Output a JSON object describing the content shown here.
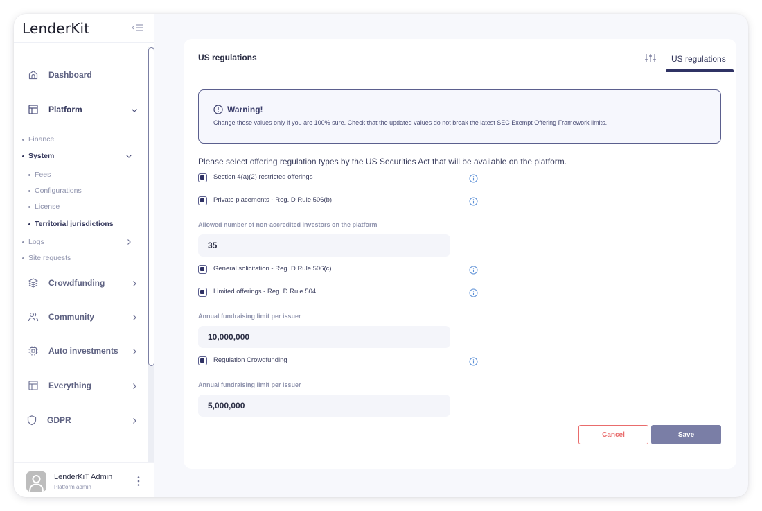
{
  "app": {
    "logo": "LenderKit"
  },
  "sidebar": {
    "collapse_icon": "collapse-menu-icon",
    "items": [
      {
        "label": "Dashboard",
        "icon": "home-icon"
      },
      {
        "label": "Platform",
        "icon": "layout-icon",
        "expanded": true
      },
      {
        "label": "Crowdfunding",
        "icon": "layers-icon"
      },
      {
        "label": "Community",
        "icon": "users-icon"
      },
      {
        "label": "Auto investments",
        "icon": "chip-icon"
      },
      {
        "label": "Everything",
        "icon": "layout-icon"
      },
      {
        "label": "GDPR",
        "icon": "shield-icon"
      }
    ],
    "platform_children": [
      {
        "label": "Finance"
      },
      {
        "label": "System",
        "expanded": true
      },
      {
        "label": "Logs"
      },
      {
        "label": "Site requests"
      }
    ],
    "system_children": [
      {
        "label": "Fees"
      },
      {
        "label": "Configurations"
      },
      {
        "label": "License"
      },
      {
        "label": "Territorial jurisdictions",
        "active": true
      }
    ],
    "user": {
      "name": "LenderKiT Admin",
      "role": "Platform admin"
    }
  },
  "main": {
    "title": "US regulations",
    "tabs": [
      {
        "label": "US regulations",
        "active": true
      }
    ],
    "warning": {
      "title": "Warning!",
      "text": "Change these values only if you are 100% sure. Check that the updated values do not break the latest SEC Exempt Offering Framework limits."
    },
    "intro": "Please select offering regulation types by the US Securities Act that will be available on the platform.",
    "options": [
      {
        "label": "Section 4(a)(2) restricted offerings",
        "checked": true
      },
      {
        "label": "Private placements - Reg. D Rule 506(b)",
        "checked": true
      },
      {
        "label": "General solicitation - Reg. D Rule 506(c)",
        "checked": true
      },
      {
        "label": "Limited offerings - Reg. D Rule 504",
        "checked": true
      },
      {
        "label": "Regulation Crowdfunding",
        "checked": true
      }
    ],
    "fields": [
      {
        "label": "Allowed number of non-accredited investors on the platform",
        "value": "35"
      },
      {
        "label": "Annual fundraising limit per issuer",
        "value": "10,000,000"
      },
      {
        "label": "Annual fundraising limit per issuer",
        "value": "5,000,000"
      }
    ],
    "buttons": {
      "cancel": "Cancel",
      "save": "Save"
    }
  },
  "colors": {
    "primary": "#2f3264",
    "save_button": "#7a7ea6",
    "cancel_button": "#e96c6c",
    "info_icon": "#5b8fd6"
  }
}
